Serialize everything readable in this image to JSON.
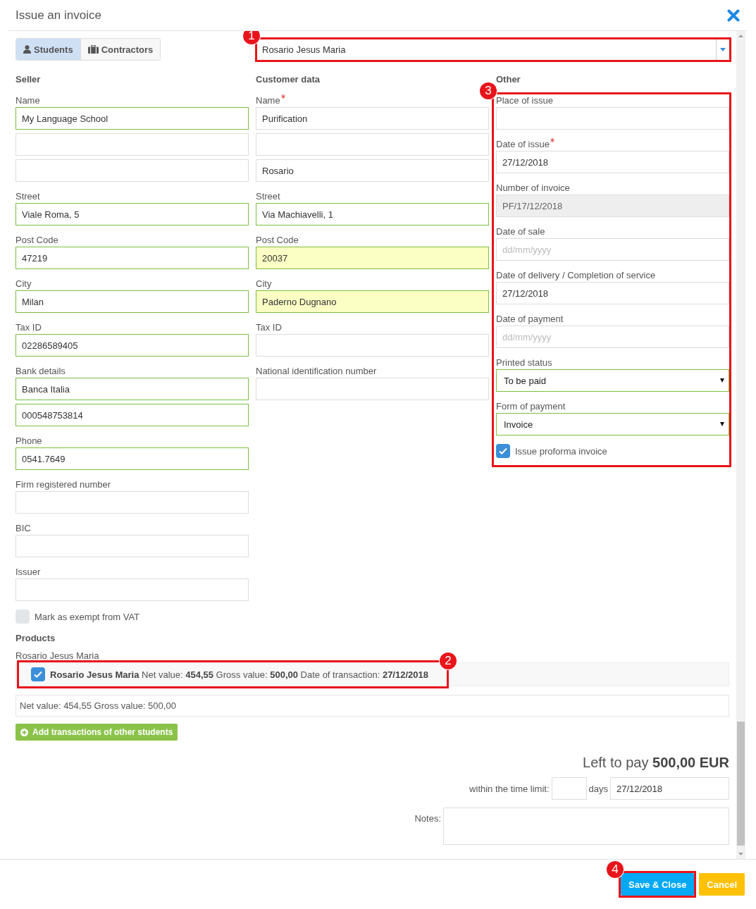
{
  "dialog": {
    "title": "Issue an invoice"
  },
  "customer_type_tabs": [
    {
      "label": "Students",
      "selected": true
    },
    {
      "label": "Contractors",
      "selected": false
    }
  ],
  "customer_picker": {
    "value": "Rosario Jesus Maria",
    "callout": "1"
  },
  "seller": {
    "heading": "Seller",
    "rows": [
      {
        "label": "Name",
        "required": false,
        "fields": [
          {
            "kind": "text",
            "value": "My Language School",
            "valid": true,
            "autofilled": false
          },
          {
            "kind": "text",
            "valid": false,
            "autofilled": false
          },
          {
            "kind": "text",
            "valid": false,
            "autofilled": false
          }
        ]
      },
      {
        "label": "Street",
        "required": false,
        "fields": [
          {
            "kind": "text",
            "value": "Viale Roma, 5",
            "valid": true,
            "autofilled": false
          }
        ]
      },
      {
        "label": "Post Code",
        "required": false,
        "fields": [
          {
            "kind": "text",
            "value": "47219",
            "valid": true,
            "autofilled": false
          }
        ]
      },
      {
        "label": "City",
        "required": false,
        "fields": [
          {
            "kind": "text",
            "value": "Milan",
            "valid": true,
            "autofilled": false
          }
        ]
      },
      {
        "label": "Tax ID",
        "required": false,
        "fields": [
          {
            "kind": "text",
            "value": "02286589405",
            "valid": true,
            "autofilled": false
          }
        ]
      },
      {
        "label": "Bank details",
        "required": false,
        "fields": [
          {
            "kind": "text",
            "value": "Banca Italia",
            "valid": true,
            "autofilled": false
          },
          {
            "kind": "text",
            "value": "000548753814",
            "valid": true,
            "autofilled": false
          }
        ]
      },
      {
        "label": "Phone",
        "required": false,
        "fields": [
          {
            "kind": "text",
            "value": "0541.7649",
            "valid": true,
            "autofilled": false
          }
        ]
      },
      {
        "label": "Firm registered number",
        "required": false,
        "fields": [
          {
            "kind": "text",
            "valid": false,
            "autofilled": false
          }
        ]
      },
      {
        "label": "BIC",
        "required": false,
        "fields": [
          {
            "kind": "text",
            "valid": false,
            "autofilled": false
          }
        ]
      },
      {
        "label": "Issuer",
        "required": false,
        "fields": [
          {
            "kind": "text",
            "valid": false,
            "autofilled": false
          }
        ]
      }
    ],
    "checkbox": {
      "label": "Mark as exempt from VAT",
      "checked": false
    }
  },
  "customer": {
    "heading": "Customer data",
    "rows": [
      {
        "label": "Name",
        "required": true,
        "fields": [
          {
            "kind": "text",
            "value": "Purification",
            "valid": false,
            "autofilled": false
          },
          {
            "kind": "text",
            "valid": false,
            "autofilled": false
          },
          {
            "kind": "text",
            "value": "Rosario",
            "valid": false,
            "autofilled": false
          }
        ]
      },
      {
        "label": "Street",
        "required": false,
        "fields": [
          {
            "kind": "text",
            "value": "Via Machiavelli, 1",
            "valid": true,
            "autofilled": false
          }
        ]
      },
      {
        "label": "Post Code",
        "required": false,
        "fields": [
          {
            "kind": "text",
            "value": "20037",
            "valid": true,
            "autofilled": true
          }
        ]
      },
      {
        "label": "City",
        "required": false,
        "fields": [
          {
            "kind": "text",
            "value": "Paderno Dugnano",
            "valid": true,
            "autofilled": true
          }
        ]
      },
      {
        "label": "Tax ID",
        "required": false,
        "fields": [
          {
            "kind": "text",
            "valid": false,
            "autofilled": false
          }
        ]
      },
      {
        "label": "National identification number",
        "required": false,
        "fields": [
          {
            "kind": "text",
            "valid": false,
            "autofilled": false
          }
        ]
      }
    ]
  },
  "other": {
    "heading": "Other",
    "callout": "3",
    "rows": [
      {
        "label": "Place of issue",
        "required": false,
        "fields": [
          {
            "kind": "text",
            "valid": false,
            "disabled": false
          }
        ]
      },
      {
        "label": "Date of issue",
        "required": true,
        "fields": [
          {
            "kind": "text",
            "value": "27/12/2018",
            "valid": false,
            "disabled": false
          }
        ]
      },
      {
        "label": "Number of invoice",
        "required": false,
        "fields": [
          {
            "kind": "text",
            "value": "PF/17/12/2018",
            "valid": false,
            "disabled": true
          }
        ]
      },
      {
        "label": "Date of sale",
        "required": false,
        "fields": [
          {
            "kind": "text",
            "placeholder": "dd/mm/yyyy",
            "valid": false,
            "disabled": false
          }
        ]
      },
      {
        "label": "Date of delivery / Completion of service",
        "required": false,
        "fields": [
          {
            "kind": "text",
            "value": "27/12/2018",
            "valid": false,
            "disabled": false
          }
        ]
      },
      {
        "label": "Date of payment",
        "required": false,
        "fields": [
          {
            "kind": "text",
            "placeholder": "dd/mm/yyyy",
            "valid": false,
            "disabled": false
          }
        ]
      },
      {
        "label": "Printed status",
        "required": false,
        "fields": [
          {
            "kind": "select",
            "value": "To be paid",
            "valid": true,
            "disabled": false
          }
        ]
      },
      {
        "label": "Form of payment",
        "required": false,
        "fields": [
          {
            "kind": "select",
            "value": "Invoice",
            "valid": true,
            "disabled": false
          }
        ]
      }
    ],
    "checkbox": {
      "label": "Issue proforma invoice",
      "checked": true
    }
  },
  "products": {
    "heading": "Products",
    "group_label": "Rosario Jesus Maria",
    "items": [
      {
        "text": "**Rosario Jesus Maria** Net value: **454,55** Gross value: **500,00** Date of transaction: **27/12/2018**",
        "checked": true,
        "callout": "2"
      }
    ],
    "summary": "Net value: 454,55 Gross value: 500,00",
    "add_button": "Add transactions of other students"
  },
  "payment": {
    "left_to_pay": "Left to pay **500,00 EUR**",
    "time_limit_label": "within the time limit:",
    "days_label": "days",
    "due_date": "27/12/2018",
    "notes_label": "Notes:"
  },
  "footer": {
    "buttons": [
      {
        "kind": "primary",
        "label": "Save & Close",
        "callout": "4"
      },
      {
        "kind": "warning",
        "label": "Cancel"
      }
    ]
  }
}
